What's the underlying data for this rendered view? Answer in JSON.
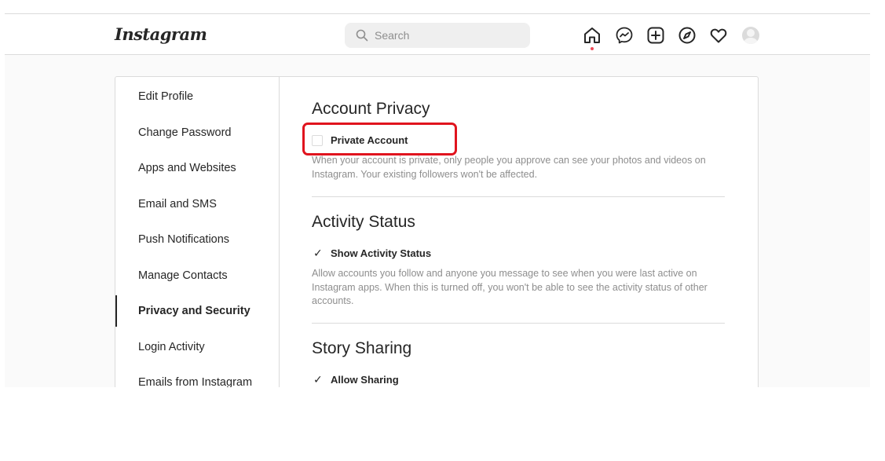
{
  "header": {
    "logo": "Instagram",
    "search_placeholder": "Search",
    "nav_icons": [
      "home-icon",
      "messenger-icon",
      "new-post-icon",
      "explore-icon",
      "activity-heart-icon"
    ],
    "notification_dot_color": "#ed4956"
  },
  "sidebar": {
    "items": [
      {
        "label": "Edit Profile",
        "active": false
      },
      {
        "label": "Change Password",
        "active": false
      },
      {
        "label": "Apps and Websites",
        "active": false
      },
      {
        "label": "Email and SMS",
        "active": false
      },
      {
        "label": "Push Notifications",
        "active": false
      },
      {
        "label": "Manage Contacts",
        "active": false
      },
      {
        "label": "Privacy and Security",
        "active": true
      },
      {
        "label": "Login Activity",
        "active": false
      },
      {
        "label": "Emails from Instagram",
        "active": false
      }
    ]
  },
  "sections": {
    "account_privacy": {
      "title": "Account Privacy",
      "checkbox_label": "Private Account",
      "checked": false,
      "description": "When your account is private, only people you approve can see your photos and videos on Instagram. Your existing followers won't be affected."
    },
    "activity_status": {
      "title": "Activity Status",
      "checkbox_label": "Show Activity Status",
      "checked": true,
      "description": "Allow accounts you follow and anyone you message to see when you were last active on Instagram apps. When this is turned off, you won't be able to see the activity status of other accounts."
    },
    "story_sharing": {
      "title": "Story Sharing",
      "checkbox_label": "Allow Sharing",
      "checked": true
    }
  },
  "colors": {
    "highlight_border": "#e0141e",
    "text_primary": "#262626",
    "text_secondary": "#8e8e8e",
    "border": "#dbdbdb"
  }
}
